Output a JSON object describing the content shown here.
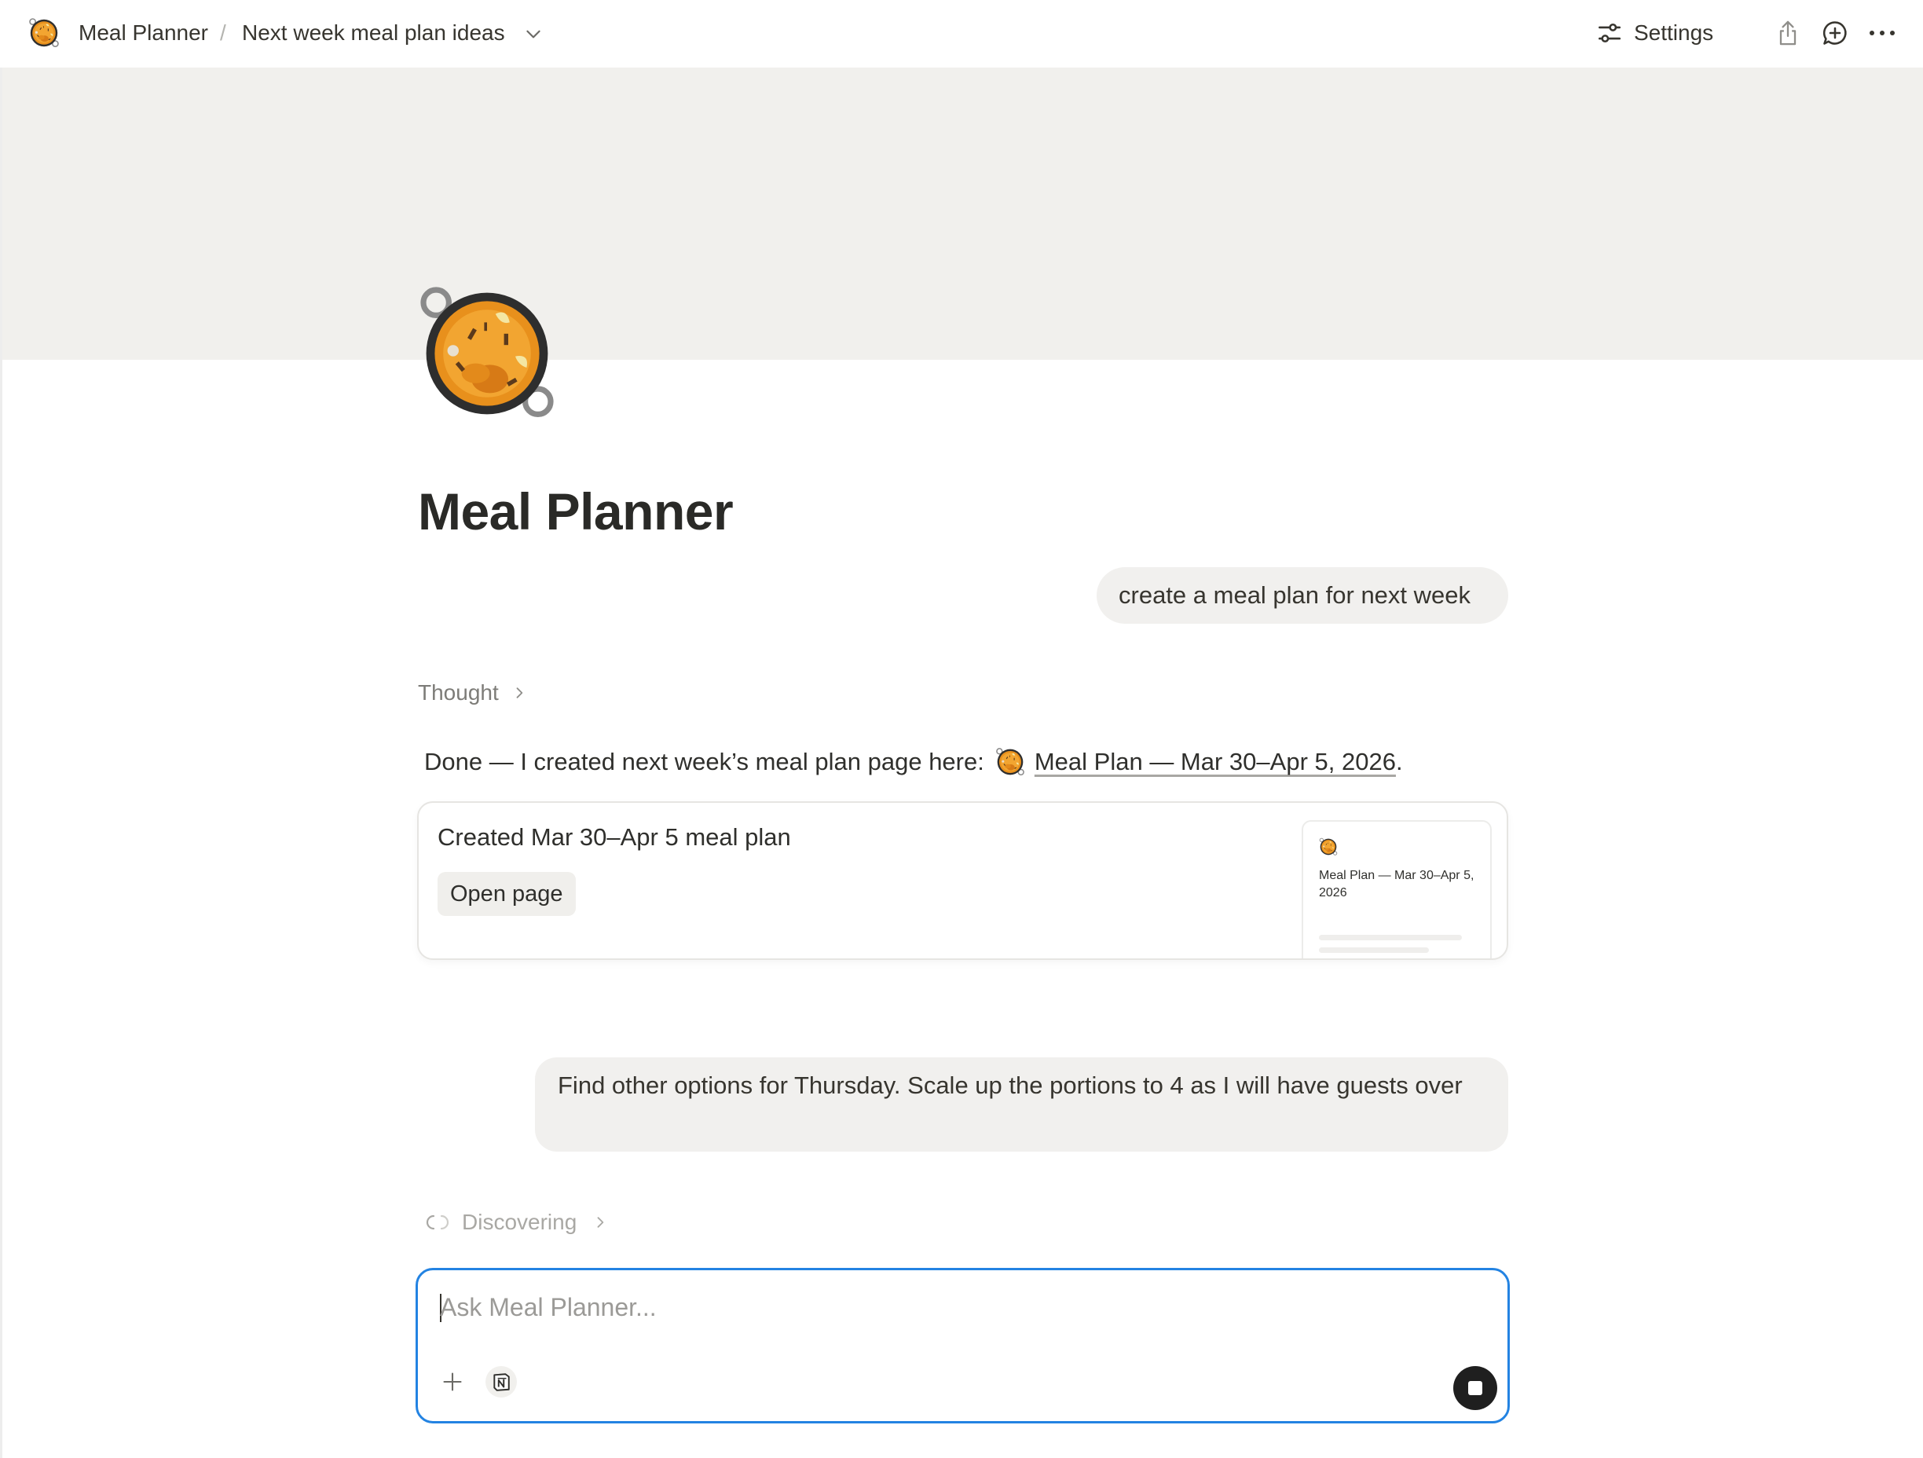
{
  "breadcrumb": {
    "workspace_icon": "paella-icon",
    "workspace": "Meal Planner",
    "separator": "/",
    "page": "Next week meal plan ideas"
  },
  "topbar": {
    "settings_label": "Settings"
  },
  "page": {
    "icon": "paella-icon",
    "title": "Meal Planner"
  },
  "chat": {
    "user_message_1": "create a meal plan for next week",
    "thought_label": "Thought",
    "answer_prefix": "Done — I created next week’s meal plan page here:",
    "answer_link": "Meal Plan — Mar 30–Apr 5, 2026",
    "answer_suffix": ".",
    "card": {
      "title": "Created Mar 30–Apr 5 meal plan",
      "open_label": "Open page",
      "preview_title": "Meal Plan — Mar 30–Apr 5, 2026"
    },
    "user_message_2": "Find other options for Thursday. Scale up the portions to 4 as I will have guests over",
    "status_label": "Discovering"
  },
  "composer": {
    "placeholder": "Ask Meal Planner...",
    "value": ""
  },
  "colors": {
    "accent": "#2383e2",
    "cover": "#f1f0ed",
    "bubble": "#f1f0ee"
  }
}
